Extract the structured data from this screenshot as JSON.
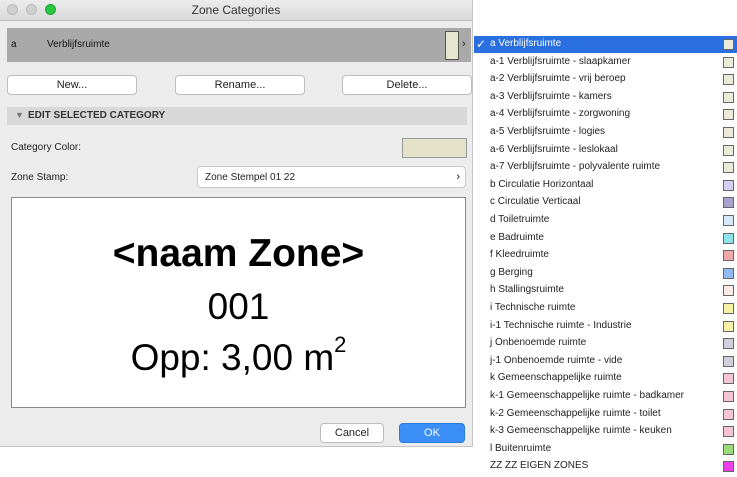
{
  "window": {
    "title": "Zone Categories"
  },
  "selected": {
    "code": "a",
    "name": "Verblijfsruimte",
    "swatch": "#e8e6cf"
  },
  "buttons": {
    "new": "New...",
    "rename": "Rename...",
    "delete": "Delete...",
    "cancel": "Cancel",
    "ok": "OK"
  },
  "section": {
    "title": "EDIT SELECTED CATEGORY"
  },
  "fields": {
    "color_label": "Category Color:",
    "color_value": "#e4e2c9",
    "stamp_label": "Zone Stamp:",
    "stamp_value": "Zone Stempel 01 22"
  },
  "preview": {
    "line1": "<naam Zone>",
    "line2": "001",
    "line3": "Opp: 3,00 m",
    "line3_sup": "2"
  },
  "menu": {
    "checkmark": "✓",
    "items": [
      {
        "label": "a Verblijfsruimte",
        "color": "#ecebd9",
        "selected": true
      },
      {
        "label": "a-1 Verblijfsruimte - slaapkamer",
        "color": "#ecebd9"
      },
      {
        "label": "a-2 Verblijfsruimte - vrij beroep",
        "color": "#ecebd9"
      },
      {
        "label": "a-3 Verblijfsruimte - kamers",
        "color": "#ecebd9"
      },
      {
        "label": "a-4 Verblijfsruimte - zorgwoning",
        "color": "#ecebd9"
      },
      {
        "label": "a-5 Verblijfsruimte - logies",
        "color": "#ecebd9"
      },
      {
        "label": "a-6 Verblijfsruimte - leslokaal",
        "color": "#ecebd9"
      },
      {
        "label": "a-7 Verblijfsruimte - polyvalente ruimte",
        "color": "#ecebd9"
      },
      {
        "label": "b Circulatie Horizontaal",
        "color": "#d3d0f4"
      },
      {
        "label": "c Circulatie Verticaal",
        "color": "#a9a2cc"
      },
      {
        "label": "d Toiletruimte",
        "color": "#d6eafa"
      },
      {
        "label": "e Badruimte",
        "color": "#8fe3ea"
      },
      {
        "label": "f Kleedruimte",
        "color": "#f1a9a9"
      },
      {
        "label": "g Berging",
        "color": "#91b9f2"
      },
      {
        "label": "h Stallingsruimte",
        "color": "#faece3"
      },
      {
        "label": "i Technische ruimte",
        "color": "#f7f0a7"
      },
      {
        "label": "i-1 Technische ruimte - Industrie",
        "color": "#f7f0a7"
      },
      {
        "label": "j Onbenoemde ruimte",
        "color": "#d1cfda"
      },
      {
        "label": "j-1 Onbenoemde ruimte - vide",
        "color": "#d1cfda"
      },
      {
        "label": "k Gemeenschappelijke ruimte",
        "color": "#f6c5d3"
      },
      {
        "label": "k-1 Gemeenschappelijke ruimte - badkamer",
        "color": "#f6c5d3"
      },
      {
        "label": "k-2 Gemeenschappelijke ruimte - toilet",
        "color": "#f6c5d3"
      },
      {
        "label": "k-3 Gemeenschappelijke ruimte - keuken",
        "color": "#f6c5d3"
      },
      {
        "label": "l Buitenruimte",
        "color": "#9bdb7a"
      },
      {
        "label": "ZZ ZZ EIGEN ZONES",
        "color": "#ec3ee9"
      }
    ]
  }
}
